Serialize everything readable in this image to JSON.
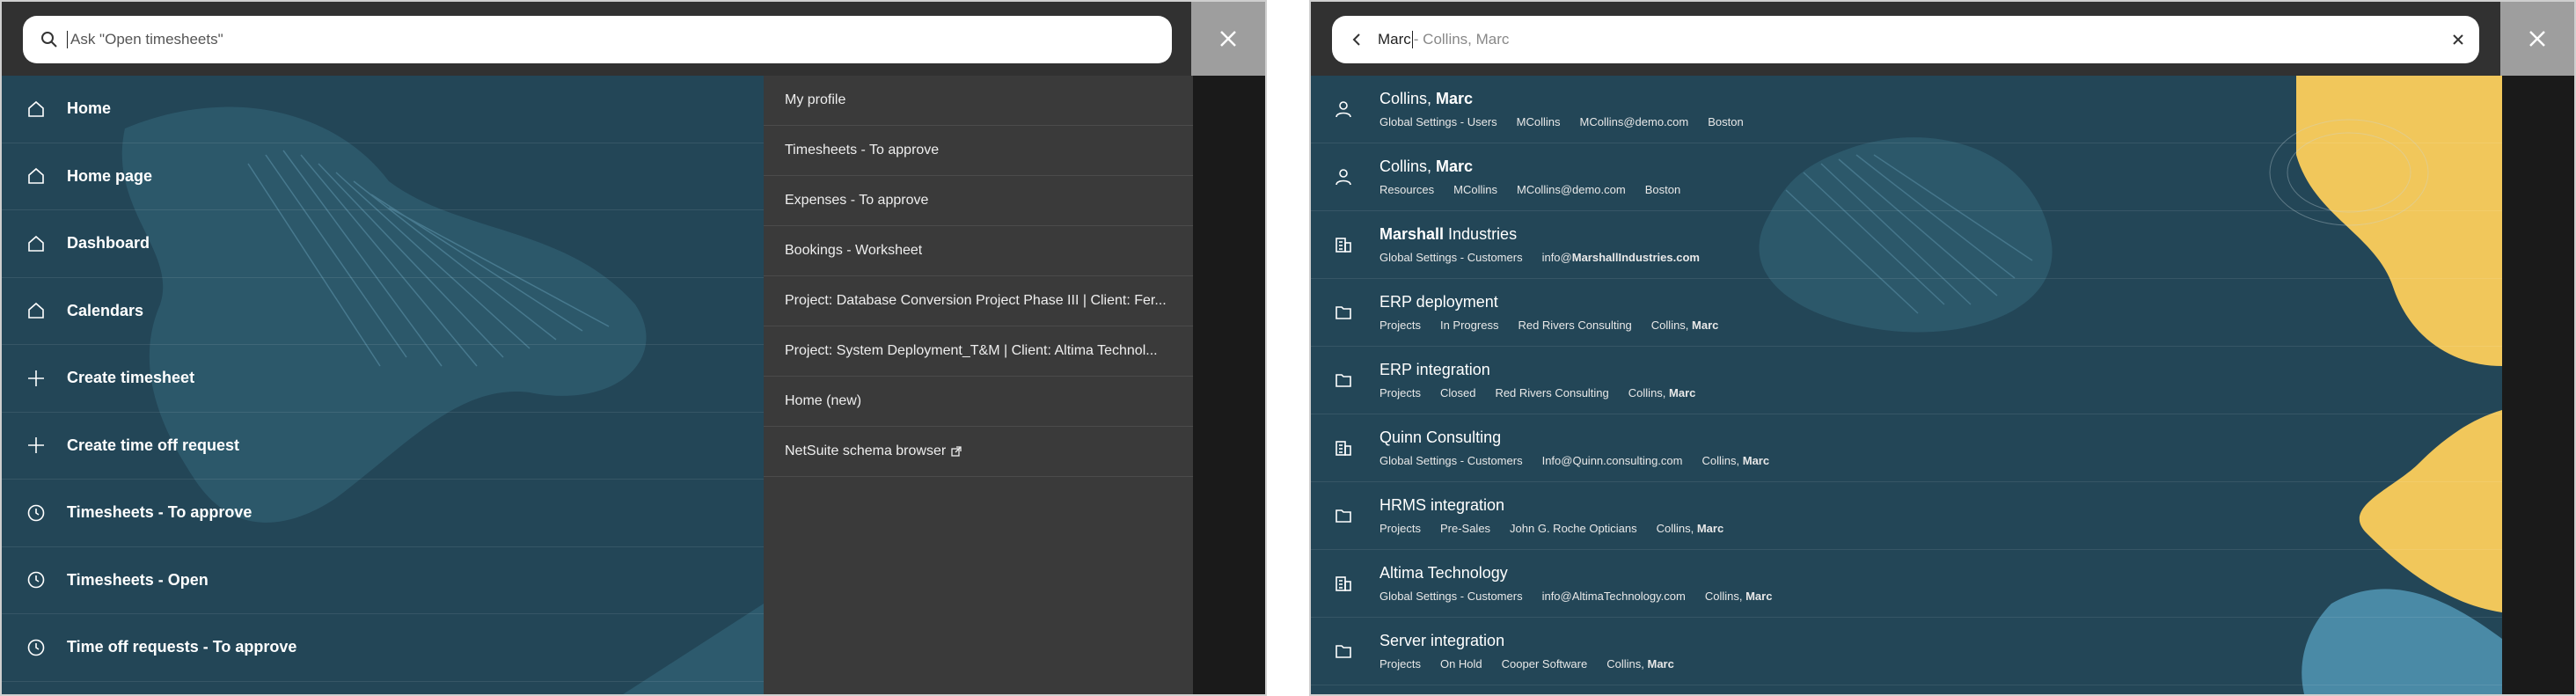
{
  "left_panel": {
    "search": {
      "placeholder": "Ask \"Open timesheets\""
    },
    "menu": [
      {
        "label": "Home",
        "icon": "home-icon"
      },
      {
        "label": "Home page",
        "icon": "home-icon"
      },
      {
        "label": "Dashboard",
        "icon": "home-icon"
      },
      {
        "label": "Calendars",
        "icon": "home-icon"
      },
      {
        "label": "Create timesheet",
        "icon": "plus-icon"
      },
      {
        "label": "Create time off request",
        "icon": "plus-icon"
      },
      {
        "label": "Timesheets - To approve",
        "icon": "clock-icon"
      },
      {
        "label": "Timesheets - Open",
        "icon": "clock-icon"
      },
      {
        "label": "Time off requests - To approve",
        "icon": "clock-icon"
      }
    ],
    "side_links": [
      "My profile",
      "Timesheets - To approve",
      "Expenses - To approve",
      "Bookings - Worksheet",
      "Project: Database Conversion Project Phase III | Client: Fer...",
      "Project: System Deployment_T&M | Client: Altima Technol...",
      "Home (new)",
      "NetSuite schema browser"
    ]
  },
  "right_panel": {
    "search": {
      "typed": "Marc",
      "suggestion": " - Collins, Marc"
    },
    "results": [
      {
        "icon": "person-icon",
        "title_parts": [
          [
            "Collins, ",
            false
          ],
          [
            "Marc",
            true
          ]
        ],
        "meta": [
          [
            [
              "Global Settings - Users",
              false
            ]
          ],
          [
            [
              "MCollins",
              false
            ]
          ],
          [
            [
              "MCollins@demo.com",
              false
            ]
          ],
          [
            [
              "Boston",
              false
            ]
          ]
        ]
      },
      {
        "icon": "person-icon",
        "title_parts": [
          [
            "Collins, ",
            false
          ],
          [
            "Marc",
            true
          ]
        ],
        "meta": [
          [
            [
              "Resources",
              false
            ]
          ],
          [
            [
              "MCollins",
              false
            ]
          ],
          [
            [
              "MCollins@demo.com",
              false
            ]
          ],
          [
            [
              "Boston",
              false
            ]
          ]
        ]
      },
      {
        "icon": "building-icon",
        "title_parts": [
          [
            "Marshall",
            true
          ],
          [
            " Industries",
            false
          ]
        ],
        "meta": [
          [
            [
              "Global Settings - Customers",
              false
            ]
          ],
          [
            [
              "info@",
              false
            ],
            [
              "MarshallIndustries.com",
              true
            ]
          ]
        ]
      },
      {
        "icon": "folder-icon",
        "title_parts": [
          [
            "ERP deployment",
            false
          ]
        ],
        "meta": [
          [
            [
              "Projects",
              false
            ]
          ],
          [
            [
              "In Progress",
              false
            ]
          ],
          [
            [
              "Red Rivers Consulting",
              false
            ]
          ],
          [
            [
              "Collins, ",
              false
            ],
            [
              "Marc",
              true
            ]
          ]
        ]
      },
      {
        "icon": "folder-icon",
        "title_parts": [
          [
            "ERP integration",
            false
          ]
        ],
        "meta": [
          [
            [
              "Projects",
              false
            ]
          ],
          [
            [
              "Closed",
              false
            ]
          ],
          [
            [
              "Red Rivers Consulting",
              false
            ]
          ],
          [
            [
              "Collins, ",
              false
            ],
            [
              "Marc",
              true
            ]
          ]
        ]
      },
      {
        "icon": "building-icon",
        "title_parts": [
          [
            "Quinn Consulting",
            false
          ]
        ],
        "meta": [
          [
            [
              "Global Settings - Customers",
              false
            ]
          ],
          [
            [
              "Info@Quinn.consulting.com",
              false
            ]
          ],
          [
            [
              "Collins, ",
              false
            ],
            [
              "Marc",
              true
            ]
          ]
        ]
      },
      {
        "icon": "folder-icon",
        "title_parts": [
          [
            "HRMS integration",
            false
          ]
        ],
        "meta": [
          [
            [
              "Projects",
              false
            ]
          ],
          [
            [
              "Pre-Sales",
              false
            ]
          ],
          [
            [
              "John G. Roche Opticians",
              false
            ]
          ],
          [
            [
              "Collins, ",
              false
            ],
            [
              "Marc",
              true
            ]
          ]
        ]
      },
      {
        "icon": "building-icon",
        "title_parts": [
          [
            "Altima Technology",
            false
          ]
        ],
        "meta": [
          [
            [
              "Global Settings - Customers",
              false
            ]
          ],
          [
            [
              "info@AltimaTechnology.com",
              false
            ]
          ],
          [
            [
              "Collins, ",
              false
            ],
            [
              "Marc",
              true
            ]
          ]
        ]
      },
      {
        "icon": "folder-icon",
        "title_parts": [
          [
            "Server integration",
            false
          ]
        ],
        "meta": [
          [
            [
              "Projects",
              false
            ]
          ],
          [
            [
              "On Hold",
              false
            ]
          ],
          [
            [
              "Cooper Software",
              false
            ]
          ],
          [
            [
              "Collins, ",
              false
            ],
            [
              "Marc",
              true
            ]
          ]
        ]
      }
    ]
  },
  "colors": {
    "panel_bg": "#234657",
    "top_bar": "#313131",
    "side_list": "#3a3a3a",
    "close_block": "#9e9e9e",
    "accent_yellow": "#f1c75b"
  }
}
